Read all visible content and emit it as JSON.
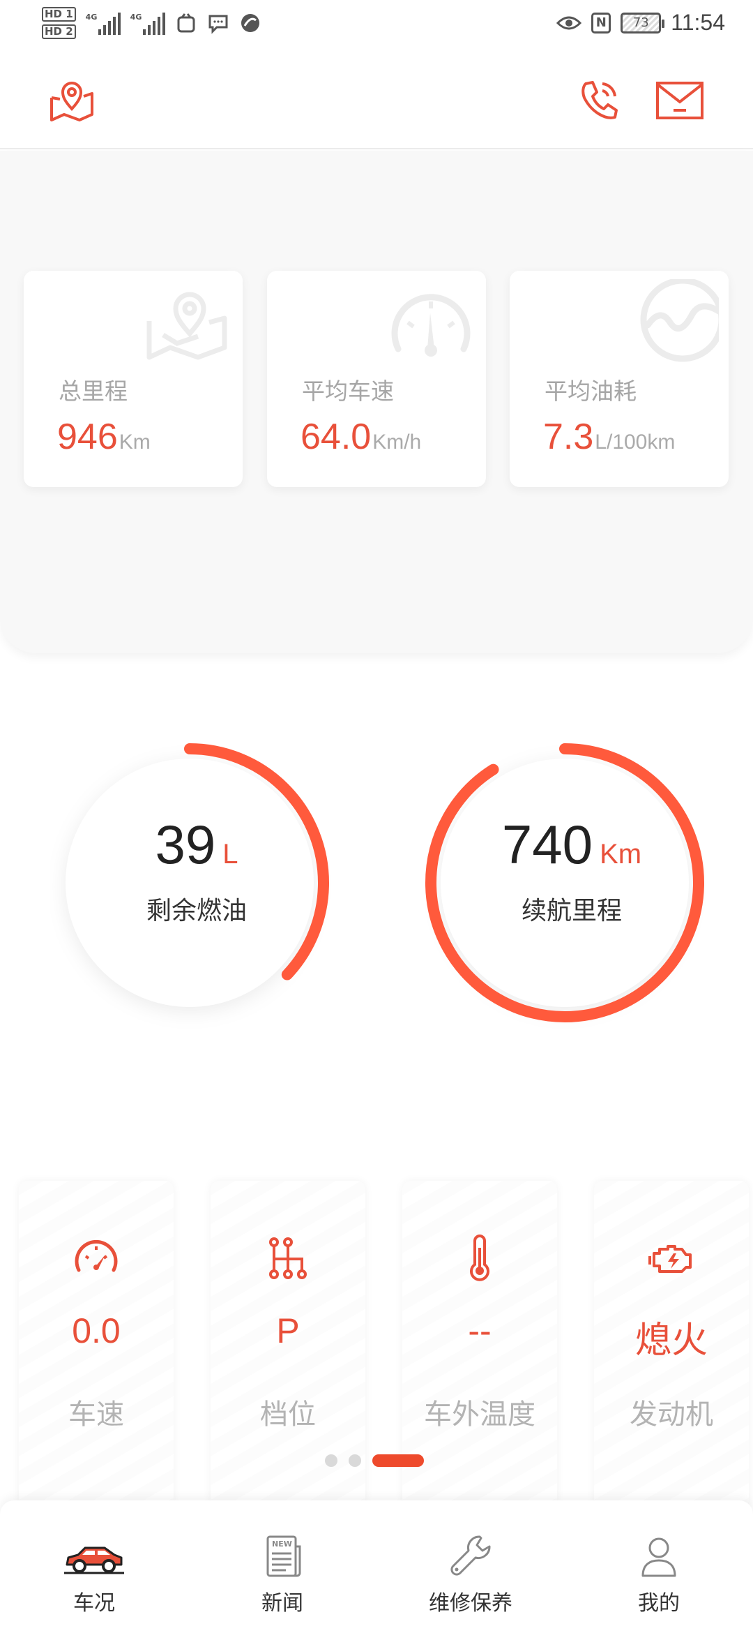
{
  "status_bar": {
    "sim1": "HD 1",
    "sim2": "HD 2",
    "net1": "4G",
    "net2": "4G",
    "battery": "73",
    "time": "11:54"
  },
  "header": {
    "icons": [
      "map-location-icon",
      "phone-icon",
      "mail-icon"
    ]
  },
  "stats": [
    {
      "label": "总里程",
      "value": "946",
      "unit": "Km",
      "icon": "map-icon"
    },
    {
      "label": "平均车速",
      "value": "64.0",
      "unit": "Km/h",
      "icon": "speedometer-icon"
    },
    {
      "label": "平均油耗",
      "value": "7.3",
      "unit": "L/100km",
      "icon": "fuel-gauge-icon"
    }
  ],
  "gauges": [
    {
      "value": "39",
      "unit": "L",
      "label": "剩余燃油",
      "fill": 0.37
    },
    {
      "value": "740",
      "unit": "Km",
      "label": "续航里程",
      "fill": 0.91
    }
  ],
  "info_cards": [
    {
      "value": "0.0",
      "label": "车速",
      "icon": "speedometer-icon"
    },
    {
      "value": "P",
      "label": "档位",
      "icon": "gear-shift-icon"
    },
    {
      "value": "--",
      "label": "车外温度",
      "icon": "thermometer-icon"
    },
    {
      "value": "熄火",
      "label": "发动机",
      "icon": "engine-icon"
    }
  ],
  "pager": {
    "count": 3,
    "active": 3
  },
  "nav": [
    {
      "label": "车况",
      "icon": "car-icon",
      "active": true
    },
    {
      "label": "新闻",
      "icon": "news-icon",
      "active": false
    },
    {
      "label": "维修保养",
      "icon": "wrench-icon",
      "active": false
    },
    {
      "label": "我的",
      "icon": "user-icon",
      "active": false
    }
  ],
  "colors": {
    "accent": "#e8503a",
    "gauge_arc": "#ff5a3c",
    "label_gray": "#a6a6a6"
  }
}
